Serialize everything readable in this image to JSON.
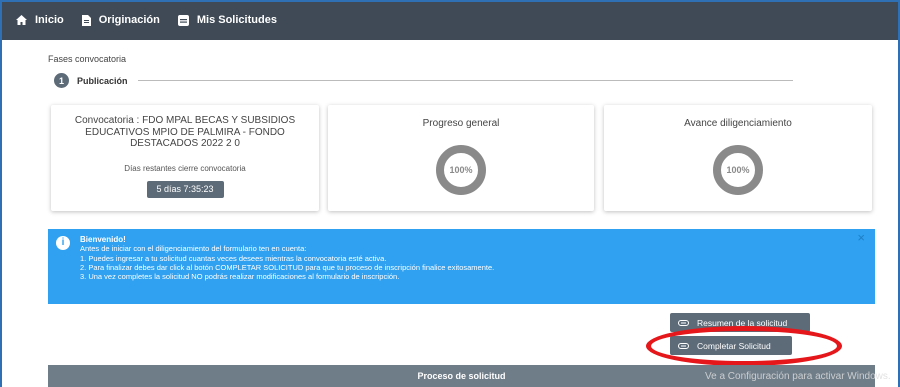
{
  "nav": {
    "items": [
      {
        "label": "Inicio",
        "icon": "home-icon"
      },
      {
        "label": "Originación",
        "icon": "document-icon"
      },
      {
        "label": "Mis Solicitudes",
        "icon": "folder-icon"
      }
    ]
  },
  "fases": {
    "title": "Fases convocatoria",
    "step_number": "1",
    "step_label": "Publicación"
  },
  "cards": {
    "convocatoria": {
      "title": "Convocatoria : FDO MPAL BECAS Y SUBSIDIOS EDUCATIVOS MPIO DE PALMIRA - FONDO DESTACADOS 2022 2 0",
      "dias_label": "Días restantes cierre convocatoria",
      "timer": "5 días 7:35:23"
    },
    "progreso": {
      "title": "Progreso general",
      "percent_label": "100%",
      "percent": 100
    },
    "avance": {
      "title": "Avance diligenciamiento",
      "percent_label": "100%",
      "percent": 100
    }
  },
  "alert": {
    "title": "Bienvenido!",
    "intro": "Antes de iniciar con el diligenciamiento del formulario ten en cuenta:",
    "line1": "1. Puedes ingresar a tu solicitud cuantas veces desees mientras la convocatoria esté activa.",
    "line2": "2. Para finalizar debes dar click al botón COMPLETAR SOLICITUD para que tu proceso de inscripción finalice exitosamente.",
    "line3": "3. Una vez completes la solicitud NO podrás realizar modificaciones al formulario de inscripción.",
    "close": "×"
  },
  "buttons": {
    "resumen": "Resumen de la solicitud",
    "completar": "Completar Solicitud"
  },
  "proceso": {
    "title": "Proceso de solicitud"
  },
  "watermark": "Ve a Configuración para activar Windows.",
  "colors": {
    "navbar": "#3f4a56",
    "alert": "#2fa1f0",
    "button": "#5d6b78",
    "highlight": "#e5171b"
  }
}
